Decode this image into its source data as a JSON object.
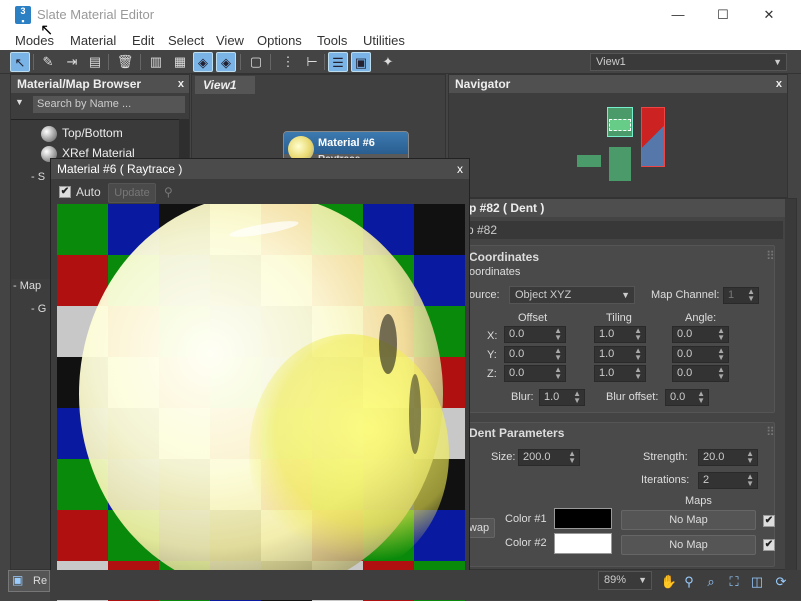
{
  "window": {
    "title": "Slate Material Editor",
    "minimize": "—",
    "maximize": "☐",
    "close": "✕"
  },
  "menu": [
    "Modes",
    "Material",
    "Edit",
    "Select",
    "View",
    "Options",
    "Tools",
    "Utilities"
  ],
  "toolbar": {
    "view_dropdown": "View1"
  },
  "browser": {
    "title": "Material/Map Browser",
    "close": "x",
    "search_placeholder": "Search by Name ...",
    "items": [
      "Top/Bottom",
      "XRef Material"
    ],
    "section_s": "S",
    "section_maps": "Map",
    "section_g": "G"
  },
  "view": {
    "tab": "View1",
    "node_title": "Material #6",
    "node_sub": "Raytrace"
  },
  "navigator": {
    "title": "Navigator",
    "close": "x"
  },
  "material_window": {
    "title": "Material #6  ( Raytrace )",
    "close": "x",
    "auto_label": "Auto",
    "update_button": "Update"
  },
  "dent": {
    "title": "p #82  ( Dent )",
    "close": "x",
    "map_name": "p #82",
    "coordinates_header": "Coordinates",
    "coordinates_sub": "oordinates",
    "source_label": "ource:",
    "source_value": "Object XYZ",
    "map_channel_label": "Map Channel:",
    "map_channel_value": "1",
    "offset_label": "Offset",
    "tiling_label": "Tiling",
    "angle_label": "Angle:",
    "axes": [
      "X:",
      "Y:",
      "Z:"
    ],
    "offset": [
      "0.0",
      "0.0",
      "0.0"
    ],
    "tiling": [
      "1.0",
      "1.0",
      "1.0"
    ],
    "angle": [
      "0.0",
      "0.0",
      "0.0"
    ],
    "blur_label": "Blur:",
    "blur_value": "1.0",
    "blur_offset_label": "Blur offset:",
    "blur_offset_value": "0.0",
    "params_header": "Dent Parameters",
    "size_label": "Size:",
    "size_value": "200.0",
    "strength_label": "Strength:",
    "strength_value": "20.0",
    "iterations_label": "Iterations:",
    "iterations_value": "2",
    "maps_label": "Maps",
    "swap_button": "wap",
    "color1_label": "Color #1",
    "color2_label": "Color #2",
    "color1": "#000000",
    "color2": "#ffffff",
    "no_map_1": "No Map",
    "no_map_2": "No Map"
  },
  "status": {
    "zoom": "89%",
    "rend_label": "Re"
  },
  "colors": {
    "accent": "#7ab4e6",
    "panel": "#444444",
    "node_header": "#3c7ab0"
  }
}
